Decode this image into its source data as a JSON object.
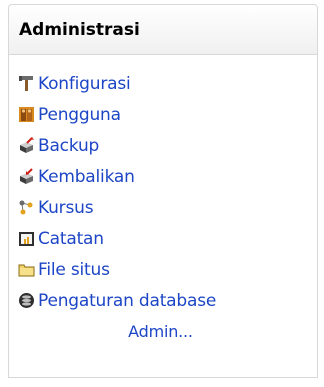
{
  "block": {
    "title": "Administrasi",
    "items": [
      {
        "label": "Konfigurasi",
        "icon": "hammer-icon"
      },
      {
        "label": "Pengguna",
        "icon": "users-icon"
      },
      {
        "label": "Backup",
        "icon": "backup-icon"
      },
      {
        "label": "Kembalikan",
        "icon": "restore-icon"
      },
      {
        "label": "Kursus",
        "icon": "course-icon"
      },
      {
        "label": "Catatan",
        "icon": "report-icon"
      },
      {
        "label": "File situs",
        "icon": "folder-icon"
      },
      {
        "label": "Pengaturan database",
        "icon": "database-icon"
      }
    ],
    "more_label": "Admin..."
  },
  "colors": {
    "link": "#1d46c6",
    "border": "#d8d8d8"
  }
}
